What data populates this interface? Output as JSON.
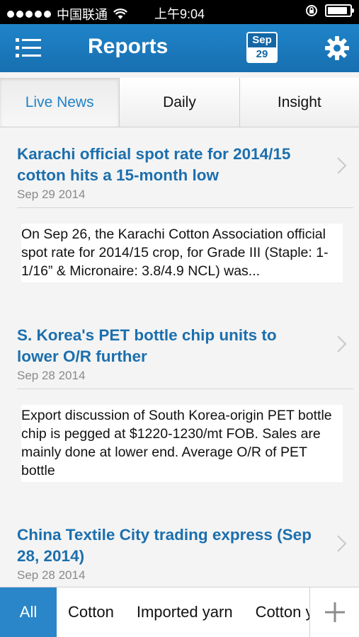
{
  "status_bar": {
    "carrier": "中国联通",
    "time": "上午9:04",
    "battery_level": 0.9
  },
  "nav": {
    "title": "Reports",
    "calendar_month": "Sep",
    "calendar_day": "29",
    "accent_color": "#1f84c9"
  },
  "tabs": [
    {
      "label": "Live News",
      "active": true
    },
    {
      "label": "Daily",
      "active": false
    },
    {
      "label": "Insight",
      "active": false
    }
  ],
  "news": [
    {
      "title": "Karachi official spot rate for 2014/15 cotton hits a 15-month low",
      "date": "Sep 29 2014",
      "summary": "On Sep 26, the Karachi Cotton Association official spot rate for 2014/15 crop, for Grade III (Staple: 1-1/16” & Micronaire: 3.8/4.9 NCL) was..."
    },
    {
      "title": "S. Korea's PET bottle chip units to lower O/R further",
      "date": "Sep 28 2014",
      "summary": "Export discussion of South Korea-origin PET bottle chip is pegged at $1220-1230/mt FOB. Sales are mainly done at lower end. Average O/R of PET bottle"
    },
    {
      "title": "China Textile City trading express (Sep 28, 2014)",
      "date": "Sep 28 2014",
      "summary": ""
    }
  ],
  "categories": [
    {
      "label": "All",
      "active": true
    },
    {
      "label": "Cotton",
      "active": false
    },
    {
      "label": "Imported yarn",
      "active": false
    },
    {
      "label": "Cotton yarn",
      "active": false
    }
  ],
  "icons": {
    "menu": "list-icon",
    "settings": "gear-icon",
    "chevron": "chevron-right-icon",
    "add": "plus-icon"
  }
}
